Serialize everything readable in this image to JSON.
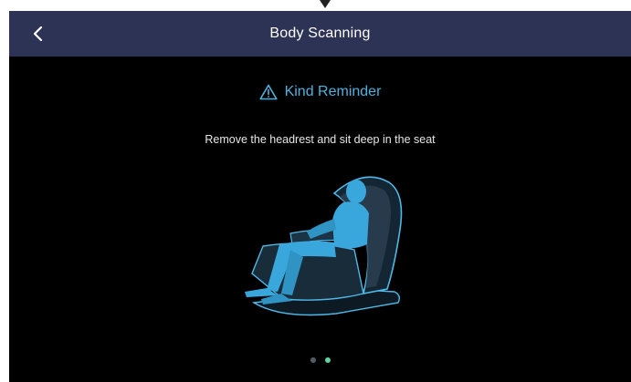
{
  "header": {
    "title": "Body Scanning",
    "back_icon": "chevron-left-icon"
  },
  "reminder": {
    "icon": "warning-triangle-icon",
    "title": "Kind Reminder",
    "instruction": "Remove the headrest and sit deep in the seat"
  },
  "illustration": {
    "subject": "massage-chair-with-seated-person",
    "accent_color": "#3aa7dc"
  },
  "pager": {
    "page_count": 2,
    "active_index": 1
  },
  "colors": {
    "header_bg": "#2c3355",
    "screen_bg": "#000000",
    "accent": "#4fb1de",
    "active_dot": "#5fd3a6",
    "inactive_dot": "#555b66"
  }
}
